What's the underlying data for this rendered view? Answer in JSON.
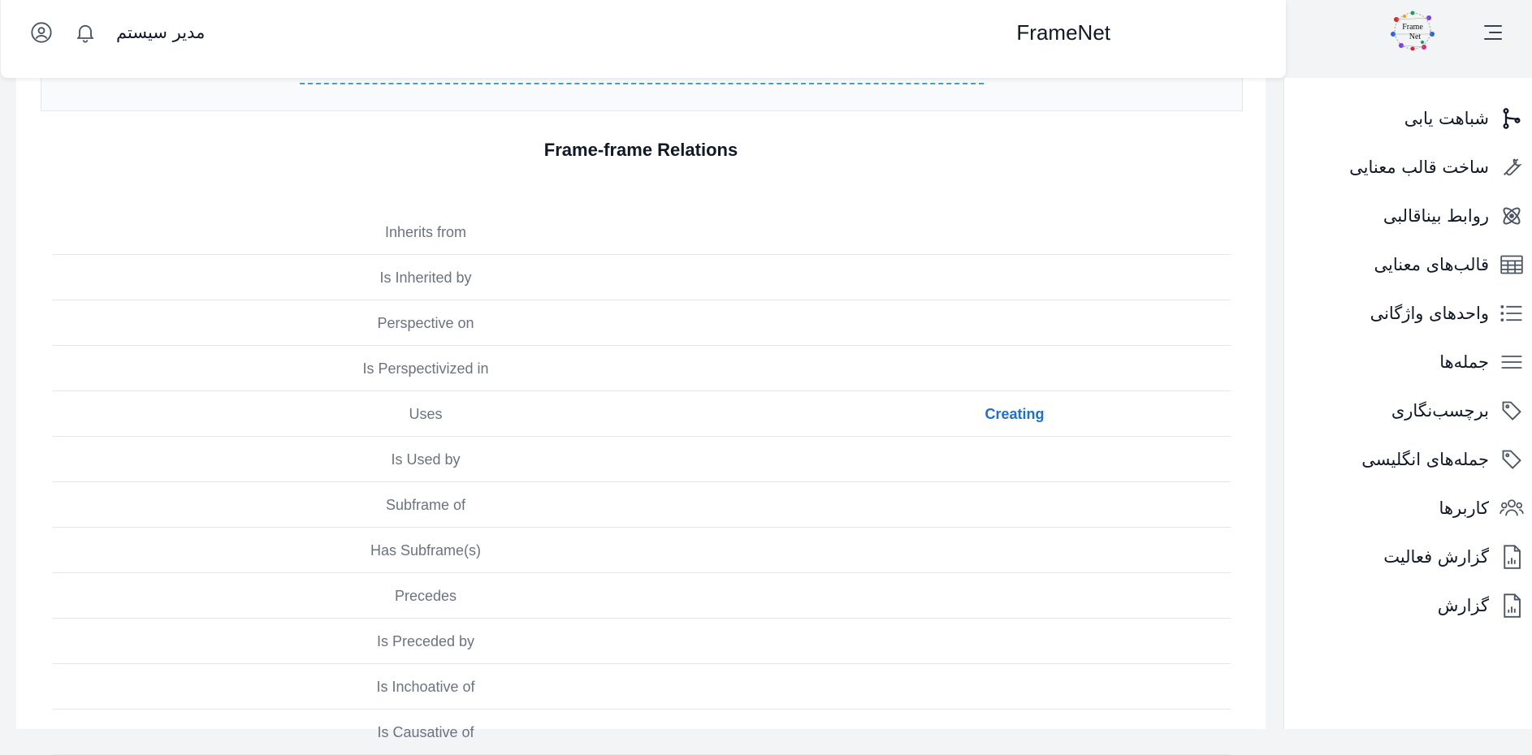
{
  "header": {
    "brand": "FrameNet",
    "logo_text": "Frame Net",
    "username": "مدیر سیستم"
  },
  "sidebar": {
    "items": [
      {
        "label": "شباهت یابی",
        "icon": "branch-icon"
      },
      {
        "label": "ساخت قالب معنایی",
        "icon": "wrench-icon"
      },
      {
        "label": "روابط بیناقالبی",
        "icon": "atom-icon"
      },
      {
        "label": "قالب‌های معنایی",
        "icon": "table-icon"
      },
      {
        "label": "واحدهای واژگانی",
        "icon": "list-icon"
      },
      {
        "label": "جمله‌ها",
        "icon": "lines-icon"
      },
      {
        "label": "برچسب‌نگاری",
        "icon": "tag-icon"
      },
      {
        "label": "جمله‌های انگلیسی",
        "icon": "tag-icon"
      },
      {
        "label": "کاربرها",
        "icon": "users-icon"
      },
      {
        "label": "گزارش فعالیت",
        "icon": "file-chart-icon"
      },
      {
        "label": "گزارش",
        "icon": "file-chart-icon"
      }
    ]
  },
  "main": {
    "section_title": "Frame-frame Relations",
    "relations": [
      {
        "name": "Inherits from",
        "value": ""
      },
      {
        "name": "Is Inherited by",
        "value": ""
      },
      {
        "name": "Perspective on",
        "value": ""
      },
      {
        "name": "Is Perspectivized in",
        "value": ""
      },
      {
        "name": "Uses",
        "value": "Creating"
      },
      {
        "name": "Is Used by",
        "value": ""
      },
      {
        "name": "Subframe of",
        "value": ""
      },
      {
        "name": "Has Subframe(s)",
        "value": ""
      },
      {
        "name": "Precedes",
        "value": ""
      },
      {
        "name": "Is Preceded by",
        "value": ""
      },
      {
        "name": "Is Inchoative of",
        "value": ""
      },
      {
        "name": "Is Causative of",
        "value": ""
      }
    ]
  },
  "colors": {
    "link": "#1d6fd6",
    "dashed_accent": "#3ba0d8"
  }
}
